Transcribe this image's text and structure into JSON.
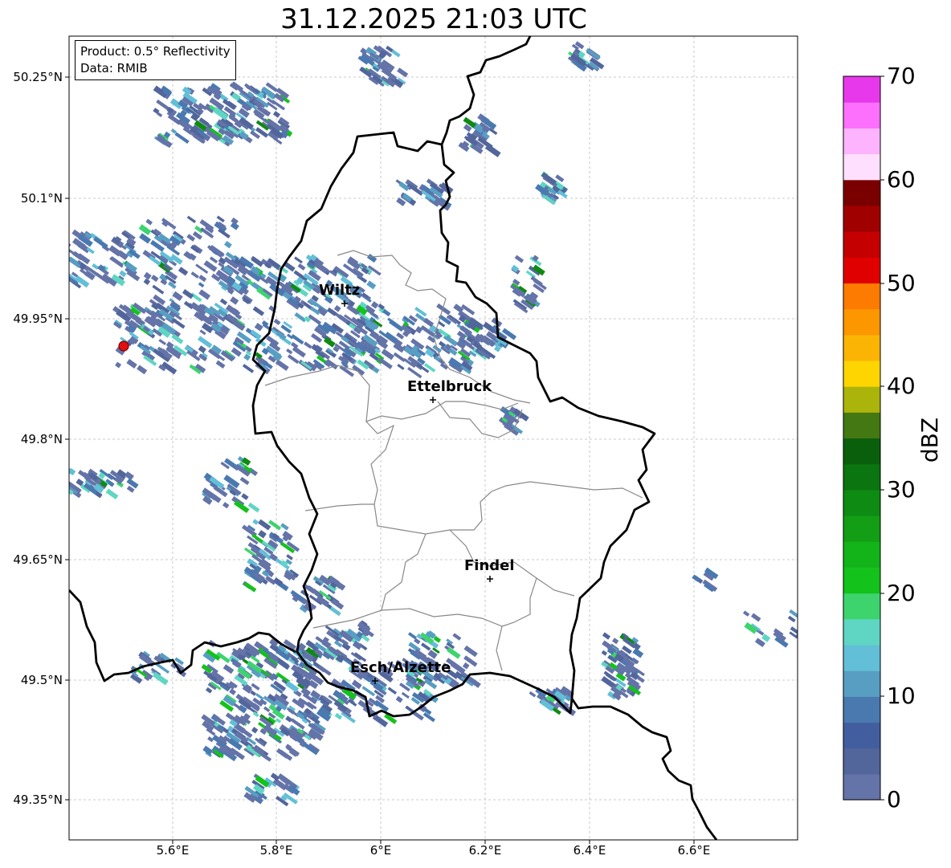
{
  "title": "31.12.2025 21:03 UTC",
  "info": {
    "product": "Product: 0.5° Reflectivity",
    "data": "Data: RMIB"
  },
  "lat_ticks": [
    "50.25°N",
    "50.1°N",
    "49.95°N",
    "49.8°N",
    "49.65°N",
    "49.5°N",
    "49.35°N"
  ],
  "lon_ticks": [
    "5.6°E",
    "5.8°E",
    "6°E",
    "6.2°E",
    "6.4°E",
    "6.6°E"
  ],
  "cities": [
    {
      "name": "Wiltz"
    },
    {
      "name": "Ettelbruck"
    },
    {
      "name": "Findel"
    },
    {
      "name": "Esch/Alzette"
    }
  ],
  "colorbar": {
    "label": "dBZ",
    "ticks": [
      "0",
      "10",
      "20",
      "30",
      "40",
      "50",
      "60",
      "70"
    ],
    "colors": [
      "#6473a8",
      "#52669c",
      "#425e9f",
      "#4a79b0",
      "#589ec3",
      "#62bfd7",
      "#5fd6c4",
      "#3dd46e",
      "#14c21c",
      "#12b41a",
      "#139e16",
      "#0e8b12",
      "#0b7510",
      "#0a5f0c",
      "#447812",
      "#abb40a",
      "#fed500",
      "#fcb404",
      "#fd9700",
      "#fd7b00",
      "#e10000",
      "#c40000",
      "#a00000",
      "#7a0000",
      "#fee0fe",
      "#fdb3fd",
      "#fd6ffd",
      "#e838eb"
    ]
  }
}
